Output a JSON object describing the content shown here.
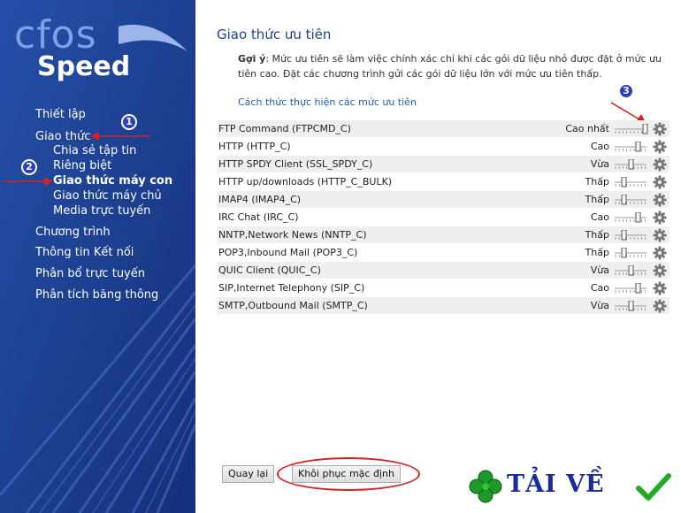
{
  "logo": {
    "line1": "cfos",
    "line2": "Speed"
  },
  "nav": {
    "items": [
      {
        "label": "Thiết lập",
        "bold": false
      },
      {
        "label": "Giao thức",
        "bold": false
      },
      {
        "label": "Chia sẻ tập tin",
        "bold": false
      },
      {
        "label": "Riêng biệt",
        "bold": false
      },
      {
        "label": "Giao thức máy con",
        "bold": true
      },
      {
        "label": "Giao thức máy chủ",
        "bold": false
      },
      {
        "label": "Media trực tuyến",
        "bold": false
      },
      {
        "label": "Chương trình",
        "bold": false
      },
      {
        "label": "Thông tin Kết nối",
        "bold": false
      },
      {
        "label": "Phân bổ trực tuyến",
        "bold": false
      },
      {
        "label": "Phân tích băng thông",
        "bold": false
      }
    ]
  },
  "annotations": {
    "one": "1",
    "two": "2",
    "three": "3"
  },
  "main": {
    "title": "Giao thức ưu tiên",
    "hint_label": "Gợi ý",
    "hint_text": ": Mức ưu tiên sẽ làm việc chính xác chỉ khi các gói dữ liệu nhỏ được đặt ở mức ưu tiên cao. Đặt các chương trình gửi các gói dữ liệu lớn với mức ưu tiên thấp.",
    "link": "Cách thức thực hiện các mức ưu tiên"
  },
  "protocols": [
    {
      "name": "FTP Command (FTPCMD_C)",
      "level": "Cao nhất",
      "pos": 1.0
    },
    {
      "name": "HTTP (HTTP_C)",
      "level": "Cao",
      "pos": 0.75
    },
    {
      "name": "HTTP SPDY Client (SSL_SPDY_C)",
      "level": "Vừa",
      "pos": 0.5
    },
    {
      "name": "HTTP up/downloads (HTTP_C_BULK)",
      "level": "Thấp",
      "pos": 0.25
    },
    {
      "name": "IMAP4 (IMAP4_C)",
      "level": "Thấp",
      "pos": 0.25
    },
    {
      "name": "IRC Chat (IRC_C)",
      "level": "Cao",
      "pos": 0.75
    },
    {
      "name": "NNTP,Network News (NNTP_C)",
      "level": "Thấp",
      "pos": 0.25
    },
    {
      "name": "POP3,Inbound Mail (POP3_C)",
      "level": "Thấp",
      "pos": 0.25
    },
    {
      "name": "QUIC Client (QUIC_C)",
      "level": "Vừa",
      "pos": 0.5
    },
    {
      "name": "SIP,Internet Telephony (SIP_C)",
      "level": "Cao",
      "pos": 0.75
    },
    {
      "name": "SMTP,Outbound Mail (SMTP_C)",
      "level": "Vừa",
      "pos": 0.5
    }
  ],
  "buttons": {
    "back": "Quay lại",
    "restore": "Khôi phục mặc định"
  },
  "brand": {
    "text": "TẢI VỀ"
  },
  "colors": {
    "sidebar": "#1f3f8f",
    "accent": "#1f5fb0",
    "annotation": "#d42020",
    "clover": "#1e9a2a",
    "check": "#22aa22"
  }
}
